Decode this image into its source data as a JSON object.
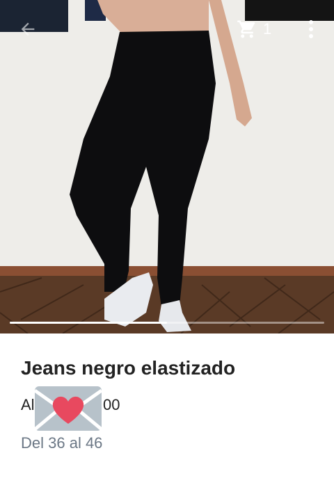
{
  "toolbar": {
    "back_icon": "arrow-back-icon",
    "cart_icon": "shopping-cart-icon",
    "cart_count": "1",
    "more_icon": "more-vertical-icon"
  },
  "carousel": {
    "progress": 0.5
  },
  "product": {
    "title": "Jeans negro elastizado",
    "price_prefix": "Al",
    "price_suffix": "00",
    "price_overlay_icon": "envelope-heart-emoji",
    "sizes": "Del 36 al 46"
  },
  "colors": {
    "title": "#222222",
    "sizes": "#6b7785",
    "heart": "#e8495f"
  }
}
